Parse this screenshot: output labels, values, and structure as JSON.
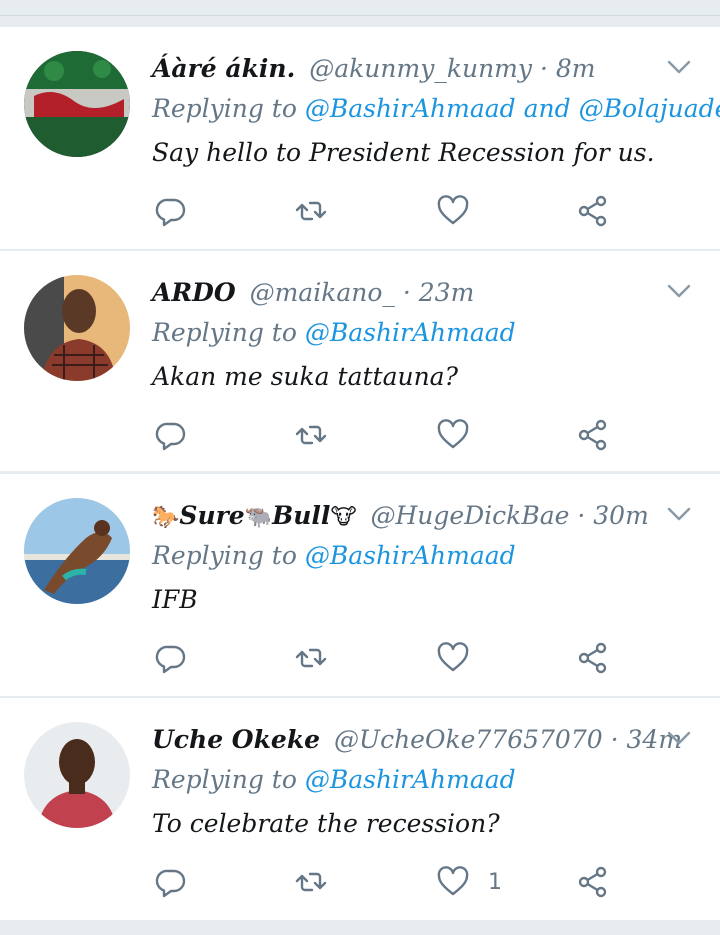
{
  "tweets": [
    {
      "name": "Áàré ákin.",
      "handle": "@akunmy_kunmy",
      "time": "8m",
      "replying_prefix": "Replying to",
      "mention1": "@BashirAhmaad",
      "conj": "and",
      "mention2": "@Bolajuade",
      "text": "Say hello to President Recession for us.",
      "likes": ""
    },
    {
      "name": "ARDO",
      "handle": "@maikano_",
      "time": "23m",
      "replying_prefix": "Replying to",
      "mention1": "@BashirAhmaad",
      "text": "Akan me suka tattauna?",
      "likes": ""
    },
    {
      "name_emoji1": "🐎",
      "name_part1": "Sure",
      "name_emoji2": "🐃",
      "name_part2": "Bull",
      "name_emoji3": "🐮",
      "handle": "@HugeDickBae",
      "time": "30m",
      "replying_prefix": "Replying to",
      "mention1": "@BashirAhmaad",
      "text": "IFB",
      "likes": ""
    },
    {
      "name": "Uche Okeke",
      "handle": "@UcheOke77657070",
      "time": "34m",
      "replying_prefix": "Replying to",
      "mention1": "@BashirAhmaad",
      "text": "To celebrate the recession?",
      "likes": "1"
    }
  ],
  "separator": "·",
  "colors": {
    "link": "#1b95e0",
    "muted": "#657786",
    "text": "#14171a",
    "background": "#e6ecf0"
  },
  "icons": [
    "reply-icon",
    "retweet-icon",
    "like-icon",
    "share-icon",
    "chevron-down-icon"
  ]
}
